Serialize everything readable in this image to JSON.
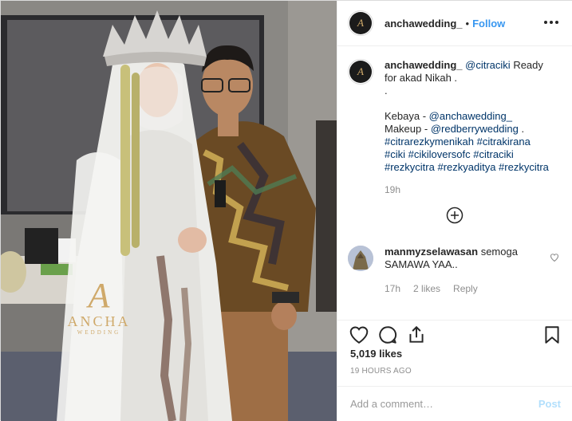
{
  "photo": {
    "watermark_monogram": "A",
    "watermark_brand": "ANCHA",
    "watermark_sub": "WEDDING"
  },
  "header": {
    "avatar_monogram": "A",
    "username": "anchawedding_",
    "separator": "•",
    "follow_label": "Follow",
    "more_icon": "more-horizontal-icon"
  },
  "caption": {
    "username": "anchawedding_",
    "mention": "@citraciki",
    "text_after_mention": " Ready for akad Nikah .",
    "dot_line": ".",
    "kebaya_label": "Kebaya - ",
    "kebaya_mention": "@anchawedding_",
    "makeup_label": "Makeup - ",
    "makeup_mention": "@redberrywedding",
    "makeup_end": " .",
    "hashtags_1": "#citrarezkymenikah #citrakirana",
    "hashtags_2": "#ciki #cikiloversofc #citraciki",
    "hashtags_3": "#rezkycitra #rezkyaditya #rezkycitra",
    "age": "19h"
  },
  "load_more_icon": "plus-circle-icon",
  "comment": {
    "username": "manmyzselawasan",
    "text": " semoga SAMAWA YAA..",
    "age": "17h",
    "likes": "2 likes",
    "reply_label": "Reply"
  },
  "actions": {
    "like_icon": "heart-icon",
    "comment_icon": "comment-icon",
    "share_icon": "share-icon",
    "save_icon": "bookmark-icon"
  },
  "likes_count": "5,019 likes",
  "timestamp": "19 HOURS AGO",
  "add_comment": {
    "placeholder": "Add a comment…",
    "post_label": "Post"
  },
  "colors": {
    "link": "#003569",
    "follow": "#3897f0",
    "post_disabled": "#b2dffc",
    "secondary_text": "#8e8e8e",
    "border": "#efefef"
  }
}
